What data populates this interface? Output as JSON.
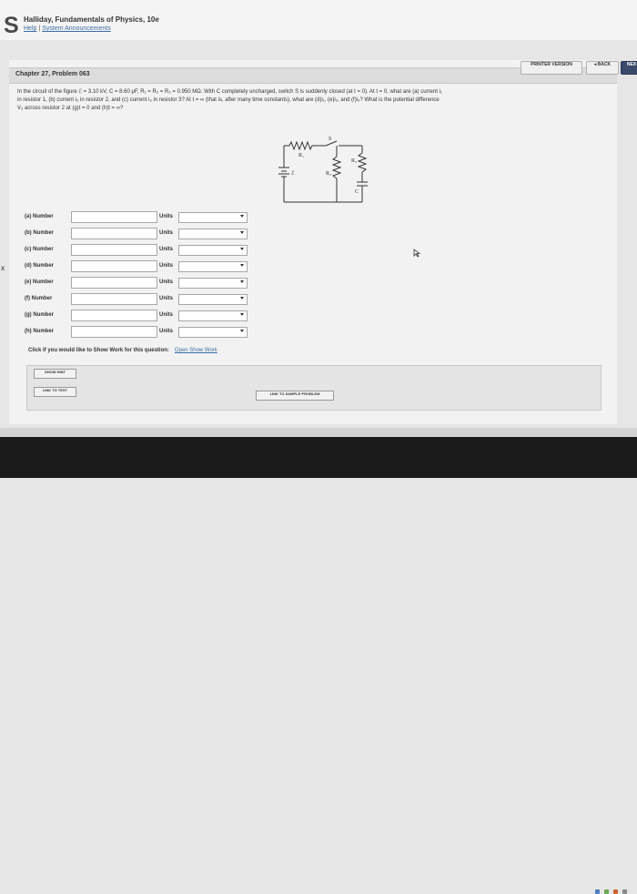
{
  "header": {
    "logo": "S",
    "course_title": "Halliday, Fundamentals of Physics, 10e",
    "links": [
      "Help",
      "System Announcements"
    ],
    "link_separator": "|"
  },
  "nav": {
    "printer_version": "PRINTER VERSION",
    "back": "◂ BACK",
    "next": "NEX"
  },
  "problem": {
    "chapter_title": "Chapter 27, Problem 063",
    "text_line1": "In the circuit of the figure ℰ = 3.10 kV, C = 8.60 μF, R₁ = R₂ = R₃ = 0.950 MΩ. With C completely uncharged, switch S is suddenly closed (at t = 0). At t = 0, what are (a) current i₁",
    "text_line2": "in resistor 1, (b) current i₂ in resistor 2, and (c) current i₃ in resistor 3? At t = ∞ (that is, after many time constants), what are (d)i₁, (e)i₂, and (f)i₃? What is the potential difference",
    "text_line3": "V₂ across resistor 2 at (g)t = 0 and (h)t = ∞?"
  },
  "circuit": {
    "labels": [
      "R₁",
      "S",
      "R₂",
      "R₃",
      "C",
      "ℰ"
    ]
  },
  "answers": [
    {
      "label": "(a) Number",
      "value": "",
      "units_label": "Units",
      "units_value": ""
    },
    {
      "label": "(b) Number",
      "value": "",
      "units_label": "Units",
      "units_value": ""
    },
    {
      "label": "(c) Number",
      "value": "",
      "units_label": "Units",
      "units_value": ""
    },
    {
      "label": "(d) Number",
      "value": "",
      "units_label": "Units",
      "units_value": ""
    },
    {
      "label": "(e) Number",
      "value": "",
      "units_label": "Units",
      "units_value": ""
    },
    {
      "label": "(f) Number",
      "value": "",
      "units_label": "Units",
      "units_value": ""
    },
    {
      "label": "(g) Number",
      "value": "",
      "units_label": "Units",
      "units_value": ""
    },
    {
      "label": "(h) Number",
      "value": "",
      "units_label": "Units",
      "units_value": ""
    }
  ],
  "show_work": {
    "prompt": "Click if you would like to Show Work for this question:",
    "link": "Open Show Work"
  },
  "buttons": {
    "show_hint": "SHOW HINT",
    "link_to_text": "LINK TO TEXT",
    "link_to_sample": "LINK TO SAMPLE PROBLEM"
  },
  "misc": {
    "x_mark": "x"
  },
  "colors": {
    "link": "#3b6ea5",
    "taskbar": "#1b1b1b",
    "next_button": "#3a4a6b"
  }
}
